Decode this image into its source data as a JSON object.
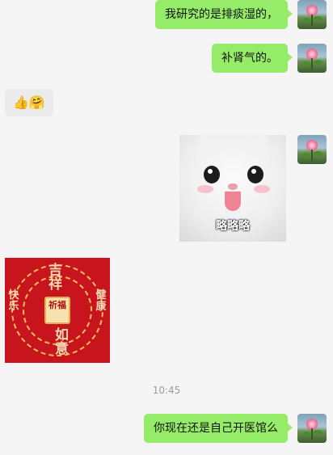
{
  "messages": {
    "m1": {
      "text": "我研究的是排痰湿的，"
    },
    "m2": {
      "text": "补肾气的。"
    },
    "m3": {
      "emoji": "👍🤗"
    },
    "m4": {
      "sticker_caption": "略略略"
    },
    "m5": {
      "image_text": {
        "top": "吉祥",
        "center": "祈福",
        "bottom": "如意",
        "left": "快乐",
        "right": "健康"
      }
    },
    "timestamp": "10:45",
    "m6": {
      "text": "你现在还是自己开医馆么"
    }
  },
  "colors": {
    "outgoing_bubble": "#95ec69",
    "incoming_bubble": "#ebebeb",
    "background": "#f5f5f5"
  }
}
